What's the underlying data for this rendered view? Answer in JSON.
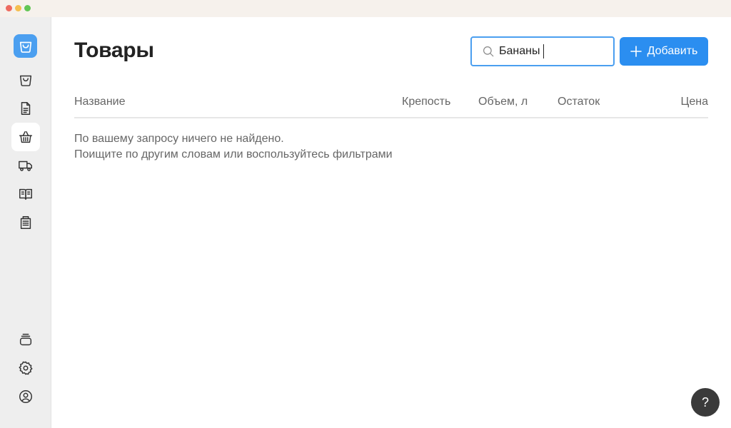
{
  "colors": {
    "accent": "#2b8ef0",
    "logo": "#4b9ff0",
    "sidebar_bg": "#eeeeee",
    "help_bg": "#3a3a3a"
  },
  "sidebar": {
    "logo_icon": "shopping-bag-icon",
    "items": [
      {
        "icon": "bag-icon"
      },
      {
        "icon": "document-icon"
      },
      {
        "icon": "basket-icon",
        "active": true
      },
      {
        "icon": "truck-icon"
      },
      {
        "icon": "book-icon"
      },
      {
        "icon": "calculator-icon"
      }
    ],
    "bottom_items": [
      {
        "icon": "stack-icon"
      },
      {
        "icon": "gear-icon"
      },
      {
        "icon": "user-icon"
      }
    ]
  },
  "header": {
    "title": "Товары",
    "search_value": "Бананы",
    "add_label": "Добавить"
  },
  "table": {
    "columns": [
      "Название",
      "Крепость",
      "Объем, л",
      "Остаток",
      "Цена"
    ],
    "rows": []
  },
  "empty_state": {
    "line1": "По вашему запросу ничего не найдено.",
    "line2": "Поищите по другим словам или воспользуйтесь фильтрами"
  },
  "help": {
    "label": "?"
  }
}
